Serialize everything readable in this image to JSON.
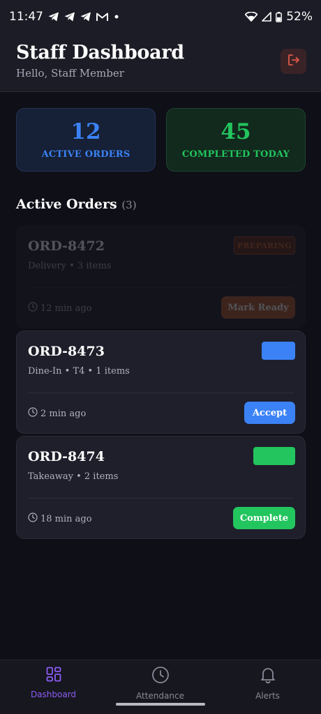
{
  "status_bar": {
    "time": "11:47",
    "battery": "52%",
    "left_icons": [
      "telegram-icon",
      "telegram-icon",
      "telegram-icon",
      "gmail-icon",
      "dot-icon"
    ],
    "right_icons": [
      "wifi-icon",
      "signal-icon",
      "battery-icon"
    ]
  },
  "header": {
    "title": "Staff Dashboard",
    "subtitle": "Hello, Staff Member",
    "logout_icon": "logout-icon"
  },
  "stats": {
    "active": {
      "value": "12",
      "label": "ACTIVE ORDERS"
    },
    "completed": {
      "value": "45",
      "label": "COMPLETED TODAY"
    }
  },
  "section": {
    "title": "Active Orders",
    "count": "(3)"
  },
  "orders": [
    {
      "id": "ORD-8472",
      "meta": "Delivery • 3 items",
      "time": "12 min ago",
      "badge": "PREPARING",
      "action": "Mark Ready"
    },
    {
      "id": "ORD-8473",
      "meta": "Dine-In • T4 • 1 items",
      "time": "2 min ago",
      "badge": "",
      "action": "Accept"
    },
    {
      "id": "ORD-8474",
      "meta": "Takeaway • 2 items",
      "time": "18 min ago",
      "badge": "",
      "action": "Complete"
    }
  ],
  "nav": {
    "items": [
      {
        "label": "Dashboard",
        "icon": "dashboard-icon"
      },
      {
        "label": "Attendance",
        "icon": "clock-icon"
      },
      {
        "label": "Alerts",
        "icon": "bell-icon"
      }
    ]
  },
  "colors": {
    "accent": "#8b5cf6",
    "blue": "#3b82f6",
    "green": "#22c55e",
    "orange": "#a0502a",
    "background": "#0f0f17"
  }
}
